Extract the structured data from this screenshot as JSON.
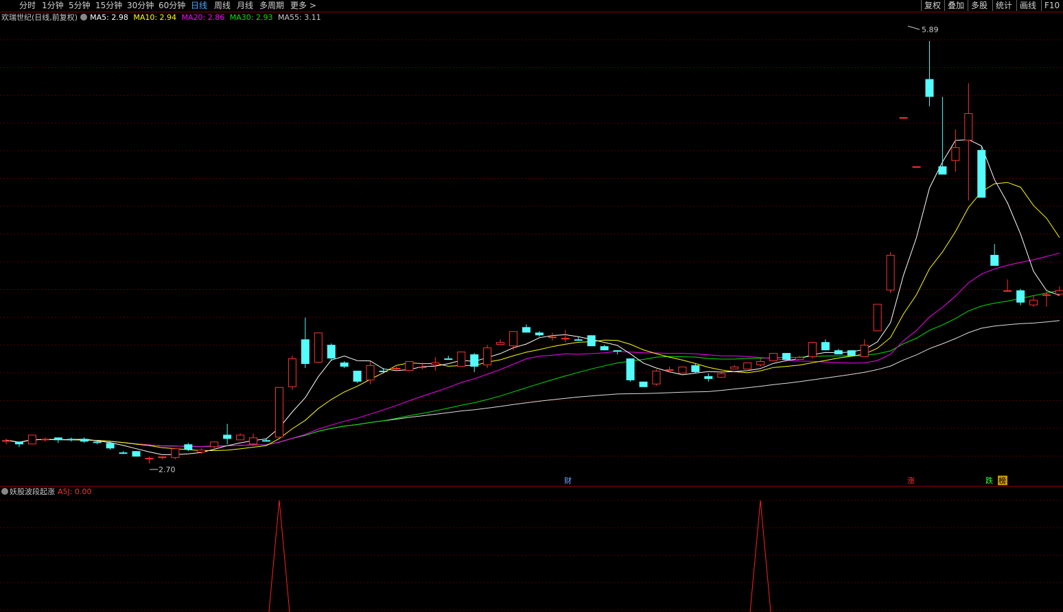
{
  "toolbar": {
    "periods": [
      "分时",
      "1分钟",
      "5分钟",
      "15分钟",
      "30分钟",
      "60分钟",
      "日线",
      "周线",
      "月线",
      "多周期",
      "更多 >"
    ],
    "active_period": "日线",
    "tools": [
      "复权",
      "叠加",
      "多股",
      "统计",
      "画线",
      "F10"
    ]
  },
  "legend": {
    "stock": "欢瑞世纪(日线,前复权)",
    "ma5_label": "MA5:",
    "ma5_value": "2.98",
    "ma10_label": "MA10:",
    "ma10_value": "2.94",
    "ma20_label": "MA20:",
    "ma20_value": "2.86",
    "ma30_label": "MA30:",
    "ma30_value": "2.93",
    "ma55_label": "MA55:",
    "ma55_value": "3.11"
  },
  "colors": {
    "up": "#ff3232",
    "down": "#54fcfc",
    "ma5": "#ffffff",
    "ma10": "#ffff00",
    "ma20": "#ff00ff",
    "ma30": "#00e600",
    "ma55": "#e0e0e0",
    "grid": "#5a0000",
    "indicator": "#ff2020"
  },
  "annotations": {
    "high_label": "5.89",
    "low_label": "2.70",
    "event_cai": "财",
    "event_zhang": "涨",
    "event_die": "跌",
    "event_bang": "榜"
  },
  "indicator": {
    "name": "妖股波段起涨",
    "value_label": "A5J:",
    "value": "0.00"
  },
  "chart_data": {
    "type": "candlestick",
    "ylim": [
      2.58,
      6.0
    ],
    "price_high": 5.89,
    "price_low": 2.7,
    "candles": [
      [
        2.86,
        2.88,
        2.84,
        2.87
      ],
      [
        2.86,
        2.86,
        2.82,
        2.84
      ],
      [
        2.84,
        2.91,
        2.84,
        2.91
      ],
      [
        2.87,
        2.89,
        2.86,
        2.88
      ],
      [
        2.89,
        2.89,
        2.85,
        2.87
      ],
      [
        2.88,
        2.89,
        2.86,
        2.87
      ],
      [
        2.88,
        2.89,
        2.85,
        2.86
      ],
      [
        2.86,
        2.87,
        2.84,
        2.85
      ],
      [
        2.85,
        2.86,
        2.8,
        2.81
      ],
      [
        2.78,
        2.79,
        2.77,
        2.77
      ],
      [
        2.79,
        2.79,
        2.75,
        2.75
      ],
      [
        2.73,
        2.75,
        2.7,
        2.74
      ],
      [
        2.74,
        2.75,
        2.73,
        2.75
      ],
      [
        2.74,
        2.81,
        2.73,
        2.81
      ],
      [
        2.84,
        2.85,
        2.79,
        2.8
      ],
      [
        2.78,
        2.81,
        2.77,
        2.8
      ],
      [
        2.82,
        2.86,
        2.81,
        2.86
      ],
      [
        2.91,
        2.99,
        2.84,
        2.88
      ],
      [
        2.87,
        2.92,
        2.87,
        2.91
      ],
      [
        2.84,
        2.92,
        2.83,
        2.89
      ],
      [
        2.87,
        2.88,
        2.86,
        2.86
      ],
      [
        2.89,
        3.26,
        2.89,
        3.26
      ],
      [
        3.26,
        3.49,
        3.24,
        3.47
      ],
      [
        3.61,
        3.77,
        3.4,
        3.43
      ],
      [
        3.44,
        3.66,
        3.44,
        3.66
      ],
      [
        3.57,
        3.58,
        3.45,
        3.47
      ],
      [
        3.44,
        3.45,
        3.4,
        3.41
      ],
      [
        3.38,
        3.38,
        3.29,
        3.3
      ],
      [
        3.31,
        3.45,
        3.28,
        3.42
      ],
      [
        3.38,
        3.4,
        3.36,
        3.37
      ],
      [
        3.39,
        3.41,
        3.38,
        3.4
      ],
      [
        3.38,
        3.45,
        3.38,
        3.45
      ],
      [
        3.4,
        3.44,
        3.39,
        3.41
      ],
      [
        3.42,
        3.48,
        3.38,
        3.44
      ],
      [
        3.47,
        3.49,
        3.46,
        3.46
      ],
      [
        3.41,
        3.52,
        3.41,
        3.52
      ],
      [
        3.5,
        3.51,
        3.37,
        3.41
      ],
      [
        3.42,
        3.57,
        3.4,
        3.55
      ],
      [
        3.57,
        3.61,
        3.57,
        3.59
      ],
      [
        3.56,
        3.67,
        3.53,
        3.67
      ],
      [
        3.7,
        3.72,
        3.66,
        3.66
      ],
      [
        3.66,
        3.67,
        3.63,
        3.64
      ],
      [
        3.63,
        3.66,
        3.6,
        3.63
      ],
      [
        3.61,
        3.68,
        3.59,
        3.62
      ],
      [
        3.61,
        3.63,
        3.6,
        3.6
      ],
      [
        3.64,
        3.64,
        3.56,
        3.56
      ],
      [
        3.56,
        3.57,
        3.53,
        3.53
      ],
      [
        3.53,
        3.52,
        3.5,
        3.52
      ],
      [
        3.47,
        3.47,
        3.3,
        3.31
      ],
      [
        3.3,
        3.3,
        3.26,
        3.26
      ],
      [
        3.28,
        3.39,
        3.27,
        3.38
      ],
      [
        3.39,
        3.41,
        3.38,
        3.39
      ],
      [
        3.36,
        3.41,
        3.36,
        3.41
      ],
      [
        3.42,
        3.43,
        3.36,
        3.37
      ],
      [
        3.34,
        3.36,
        3.3,
        3.32
      ],
      [
        3.33,
        3.37,
        3.33,
        3.36
      ],
      [
        3.39,
        3.42,
        3.39,
        3.41
      ],
      [
        3.39,
        3.44,
        3.39,
        3.44
      ],
      [
        3.42,
        3.47,
        3.41,
        3.45
      ],
      [
        3.45,
        3.51,
        3.45,
        3.51
      ],
      [
        3.51,
        3.51,
        3.46,
        3.46
      ],
      [
        3.46,
        3.49,
        3.46,
        3.48
      ],
      [
        3.48,
        3.59,
        3.47,
        3.59
      ],
      [
        3.59,
        3.61,
        3.53,
        3.53
      ],
      [
        3.53,
        3.54,
        3.5,
        3.5
      ],
      [
        3.53,
        3.53,
        3.49,
        3.49
      ],
      [
        3.48,
        3.61,
        3.48,
        3.57
      ],
      [
        3.67,
        3.87,
        3.67,
        3.87
      ],
      [
        3.97,
        4.25,
        3.95,
        4.23
      ],
      [
        5.24,
        5.24,
        5.24,
        5.24
      ],
      [
        4.88,
        4.88,
        4.88,
        4.88
      ],
      [
        5.52,
        5.8,
        5.32,
        5.39
      ],
      [
        4.88,
        5.39,
        4.82,
        4.82
      ],
      [
        4.92,
        5.15,
        4.84,
        5.02
      ],
      [
        5.07,
        5.49,
        4.63,
        5.27
      ],
      [
        5.0,
        5.03,
        4.65,
        4.65
      ],
      [
        4.23,
        4.31,
        4.15,
        4.15
      ],
      [
        3.97,
        4.05,
        3.96,
        3.97
      ],
      [
        3.97,
        3.98,
        3.86,
        3.88
      ],
      [
        3.86,
        3.93,
        3.85,
        3.9
      ],
      [
        3.93,
        3.96,
        3.85,
        3.94
      ],
      [
        3.94,
        4.0,
        3.93,
        3.97
      ]
    ],
    "ma5_end": 2.98,
    "ma10_end": 2.94,
    "ma20_end": 2.86,
    "ma30_end": 2.93,
    "ma55_end": 3.11,
    "signals_index": [
      21,
      58
    ]
  }
}
